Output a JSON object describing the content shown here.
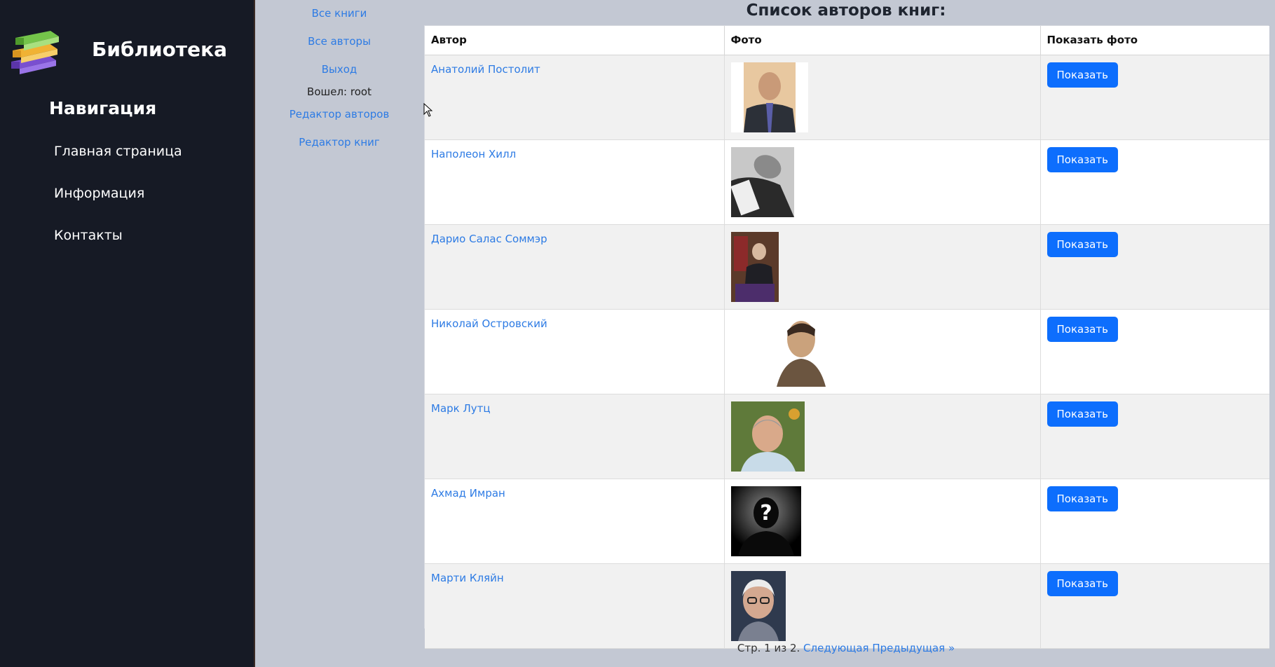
{
  "sidebar": {
    "brand_title": "Библиотека",
    "nav_heading": "Навигация",
    "items": [
      {
        "label": "Главная страница"
      },
      {
        "label": "Информация"
      },
      {
        "label": "Контакты"
      }
    ]
  },
  "mid_nav": {
    "all_books": "Все книги",
    "all_authors": "Все авторы",
    "logout": "Выход",
    "logged_in": "Вошел: root",
    "author_editor": "Редактор авторов",
    "book_editor": "Редактор книг"
  },
  "main": {
    "title": "Список авторов книг:",
    "columns": [
      "Автор",
      "Фото",
      "Показать фото"
    ],
    "rows": [
      {
        "author": "Анатолий Постолит",
        "photo_icon": "portrait-man-suit",
        "button": "Показать"
      },
      {
        "author": "Наполеон Хилл",
        "photo_icon": "portrait-bw-book",
        "button": "Показать"
      },
      {
        "author": "Дарио Салас Соммэр",
        "photo_icon": "portrait-seated-man",
        "button": "Показать"
      },
      {
        "author": "Николай Островский",
        "photo_icon": "portrait-drawing",
        "button": "Показать"
      },
      {
        "author": "Марк Лутц",
        "photo_icon": "portrait-man-glasses",
        "button": "Показать"
      },
      {
        "author": "Ахмад Имран",
        "photo_icon": "unknown-silhouette",
        "button": "Показать"
      },
      {
        "author": "Марти Кляйн",
        "photo_icon": "portrait-elderly-man",
        "button": "Показать"
      }
    ]
  },
  "pagination": {
    "text": "Стр. 1 из 2.",
    "next": "Следующая",
    "prev": "Предыдущая »"
  },
  "colors": {
    "sidebar_bg": "#161a25",
    "page_bg": "#c3c8d3",
    "link": "#2d7be4",
    "button": "#0d6efd"
  }
}
